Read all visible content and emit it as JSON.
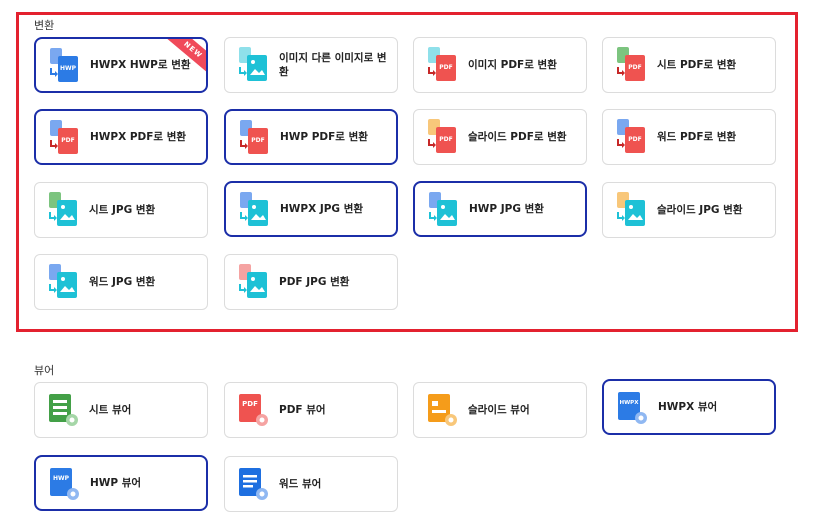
{
  "sections": {
    "convert_title": "변환",
    "viewer_title": "뷰어"
  },
  "convert_items": [
    {
      "label": "HWPX HWP로 변환",
      "badge": "NEW"
    },
    {
      "label": "이미지 다른 이미지로 변환"
    },
    {
      "label": "이미지 PDF로 변환"
    },
    {
      "label": "시트 PDF로 변환"
    },
    {
      "label": "HWPX PDF로 변환"
    },
    {
      "label": "HWP PDF로 변환"
    },
    {
      "label": "슬라이드 PDF로 변환"
    },
    {
      "label": "워드 PDF로 변환"
    },
    {
      "label": "시트 JPG 변환"
    },
    {
      "label": "HWPX JPG 변환"
    },
    {
      "label": "HWP JPG 변환"
    },
    {
      "label": "슬라이드 JPG 변환"
    },
    {
      "label": "워드 JPG 변환"
    },
    {
      "label": "PDF JPG 변환"
    }
  ],
  "viewer_items": [
    {
      "label": "시트 뷰어"
    },
    {
      "label": "PDF 뷰어"
    },
    {
      "label": "슬라이드 뷰어"
    },
    {
      "label": "HWPX 뷰어"
    },
    {
      "label": "HWP 뷰어"
    },
    {
      "label": "워드 뷰어"
    }
  ],
  "icon_text": {
    "hwp": "HWP",
    "pdf": "PDF",
    "hwpx": "HWPX"
  },
  "colors": {
    "highlight_border": "#1b2ea8",
    "red_frame": "#e3212f",
    "hwp_blue": "#2c7be5",
    "pdf_red": "#ef5350",
    "sheet_green": "#43a047",
    "slide_orange": "#f59c1a",
    "word_blue": "#1e6fe0",
    "image_teal": "#1ec1d6"
  }
}
